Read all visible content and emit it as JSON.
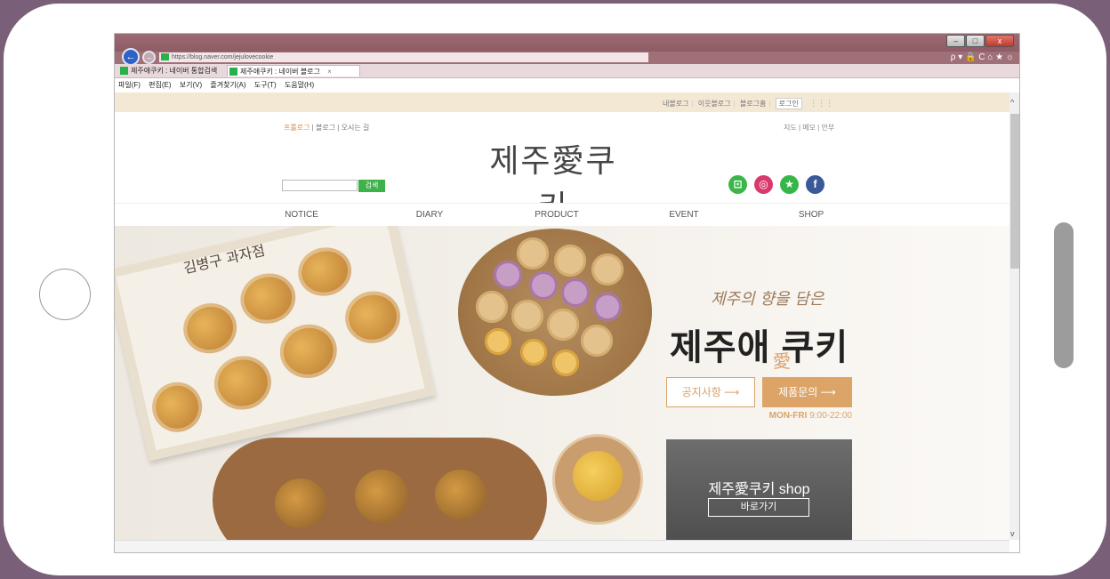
{
  "browser": {
    "url": "https://blog.naver.com/jejulovecookie",
    "tabs": [
      {
        "label": "제주애쿠키 : 네이버 통합검색"
      },
      {
        "label": "제주애쿠키 : 네이버 블로그",
        "close": "×"
      }
    ],
    "menu": [
      "파일(F)",
      "편집(E)",
      "보기(V)",
      "즐겨찾기(A)",
      "도구(T)",
      "도움말(H)"
    ],
    "right_icons": "ρ ▾ 🔒 C   ⌂ ★ ☼",
    "window_controls": {
      "minimize": "–",
      "maximize": "□",
      "close": "x"
    }
  },
  "blog": {
    "top_links": [
      "내블로그",
      "이웃블로그",
      "블로그홈"
    ],
    "login": "로그인",
    "grid_icon": "⋮⋮⋮",
    "left_links": [
      "프롤로그",
      "블로그",
      "오시는 길"
    ],
    "right_links": "지도 | 메모 | 안부",
    "title": "제주愛쿠키",
    "search_button": "검색",
    "social": [
      {
        "icon": "naver-store-icon",
        "glyph": "⊡"
      },
      {
        "icon": "instagram-icon",
        "glyph": "◎"
      },
      {
        "icon": "star-icon",
        "glyph": "★"
      },
      {
        "icon": "facebook-icon",
        "glyph": "f"
      }
    ],
    "nav": [
      "NOTICE",
      "DIARY",
      "PRODUCT",
      "EVENT",
      "SHOP"
    ]
  },
  "hero": {
    "box_label": "김병구 과자점",
    "tagline": "제주의 향을 담은",
    "headline": "제주애 쿠키",
    "headline_char": "愛",
    "notice_button": "공지사항 ⟶",
    "inquiry_button": "제품문의 ⟶",
    "hours_days": "MON-FRI",
    "hours_time": " 9:00-22:00",
    "shop_title": "제주愛쿠키 shop",
    "shop_button": "바로가기"
  },
  "scroll": {
    "up": "^",
    "down": "v"
  }
}
